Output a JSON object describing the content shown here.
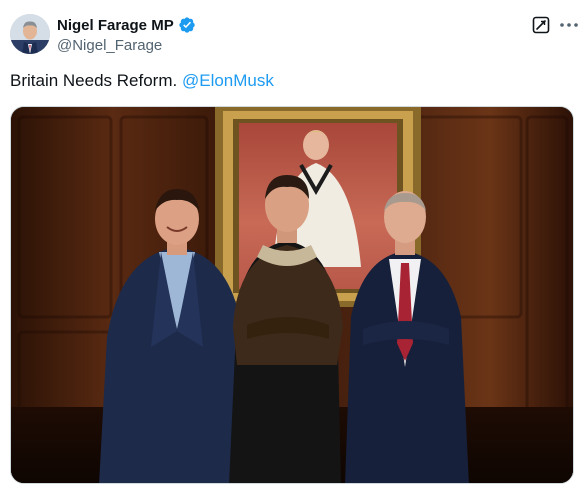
{
  "author": {
    "display_name": "Nigel Farage MP",
    "handle": "@Nigel_Farage",
    "verified": true,
    "avatar_icon": "profile-photo"
  },
  "tweet": {
    "text": "Britain Needs Reform.",
    "mention": "@ElonMusk"
  },
  "actions": {
    "grok_icon": "grok-icon",
    "more_icon": "more-icon"
  },
  "media": {
    "type": "photo",
    "alt": ""
  },
  "colors": {
    "accent": "#1d9bf0",
    "text": "#0f1419",
    "secondary": "#536471",
    "border": "#cfd9de"
  }
}
